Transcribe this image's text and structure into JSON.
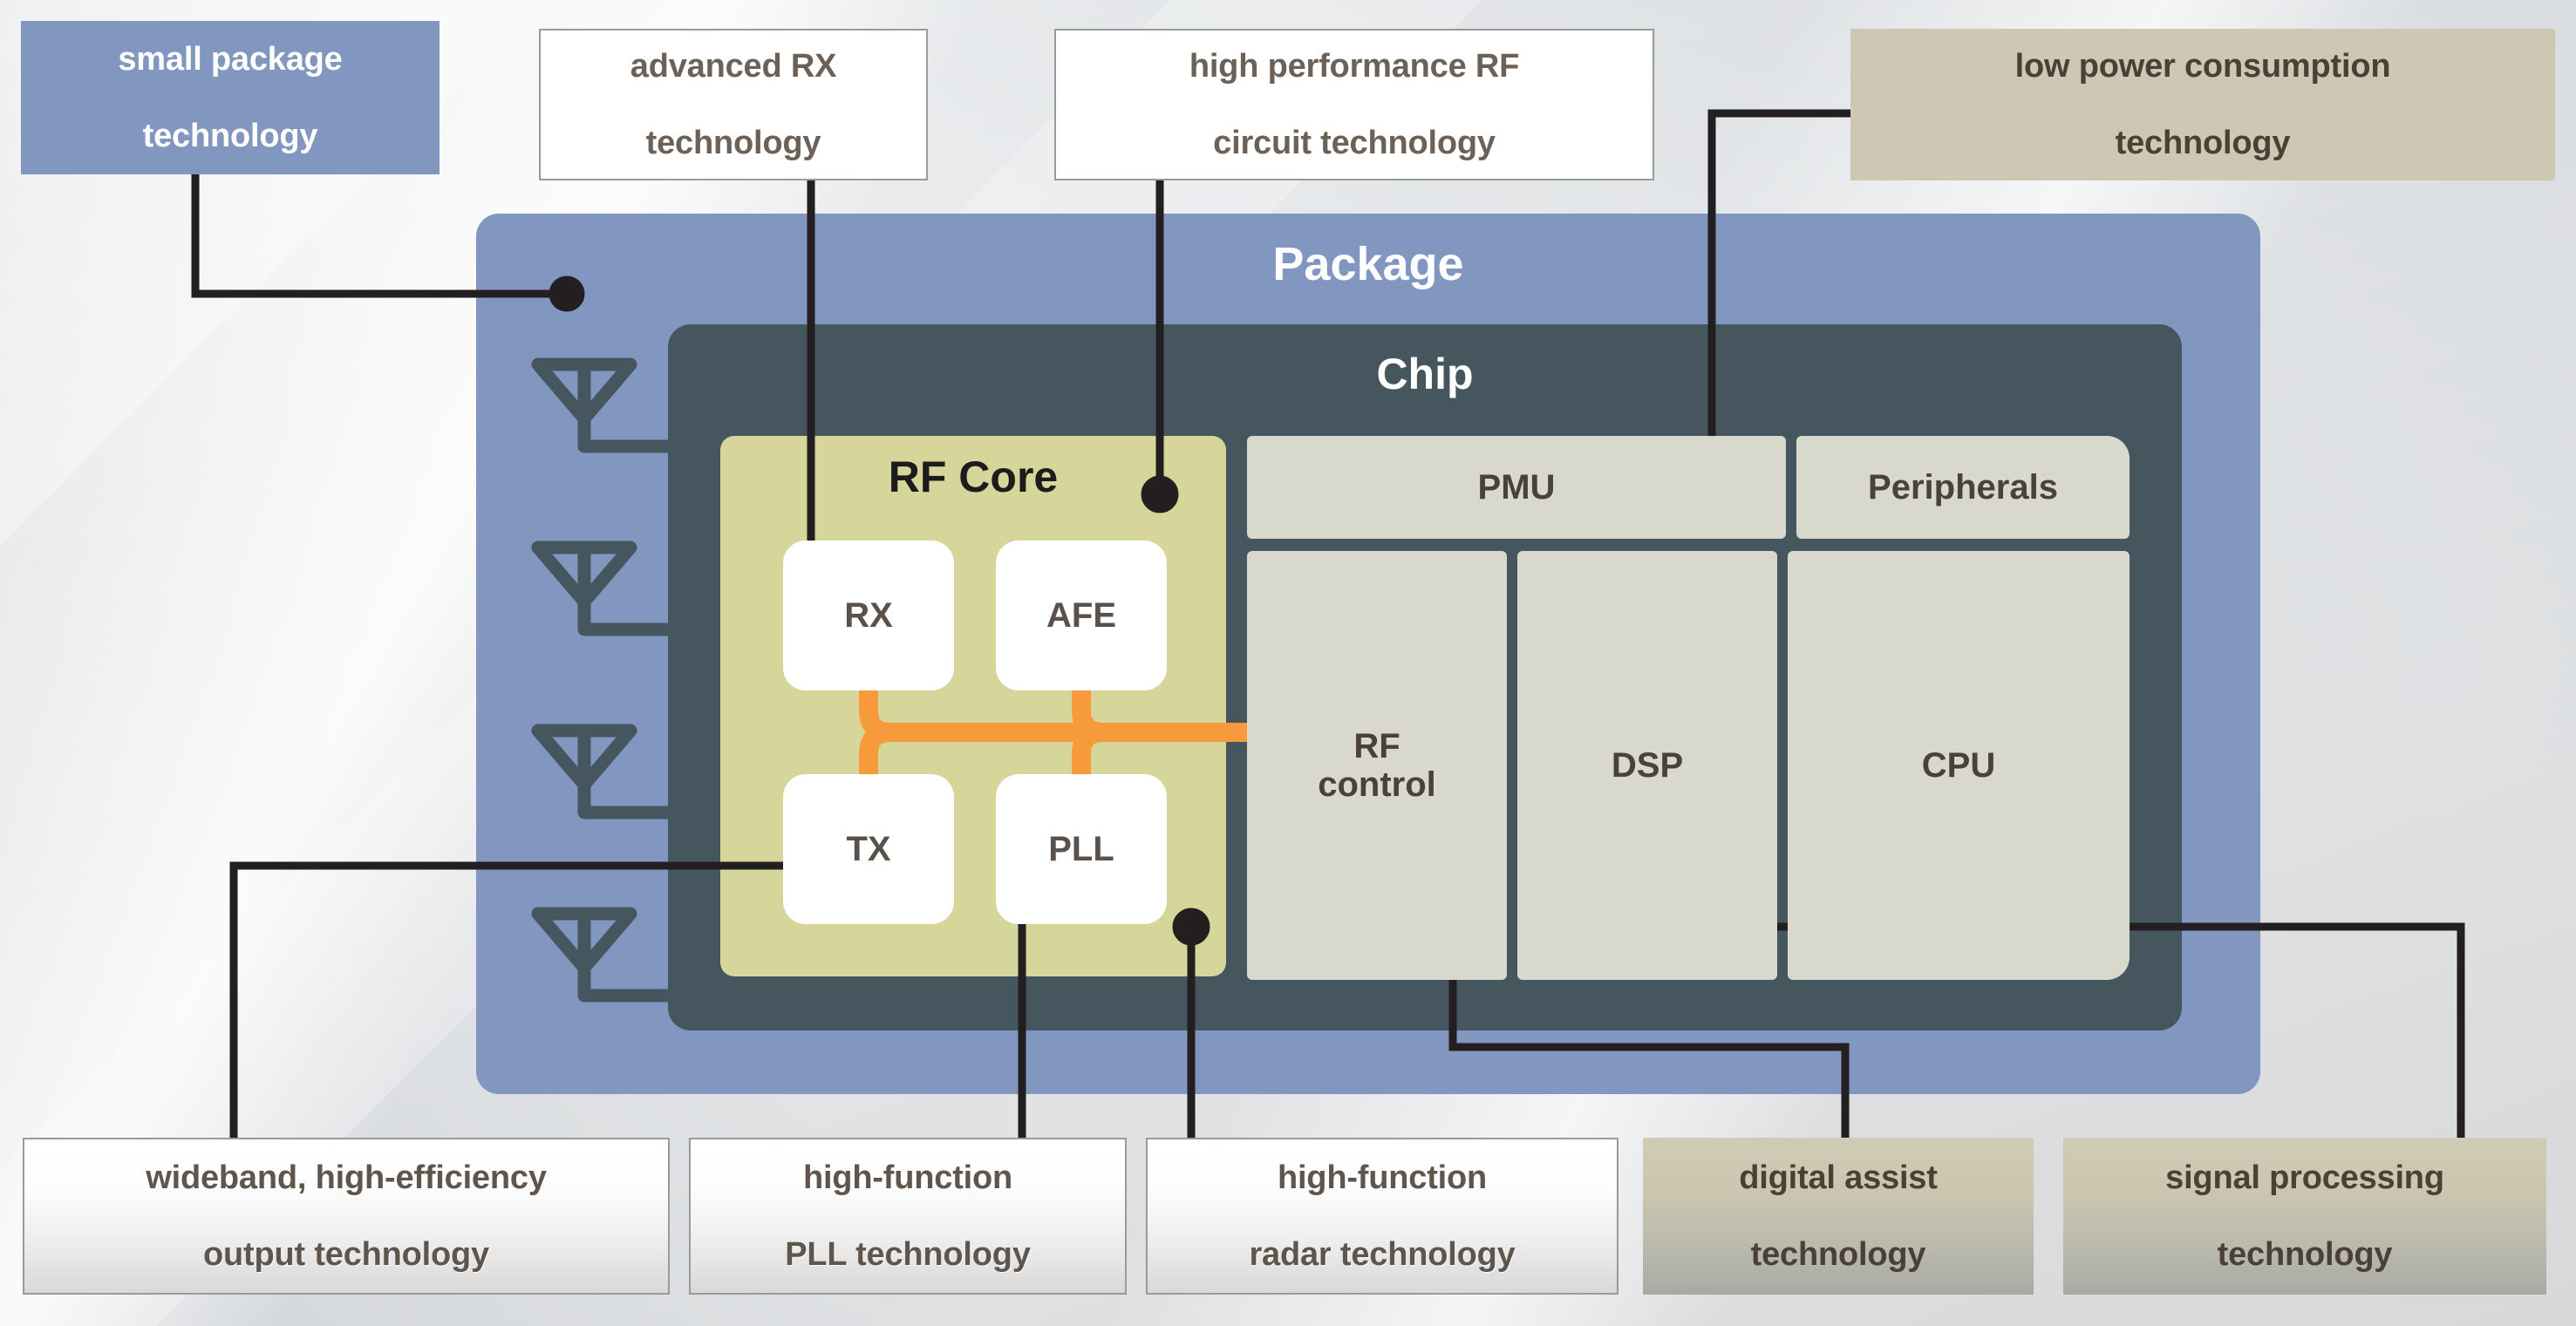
{
  "diagram": {
    "title": "RF SoC package / chip block diagram",
    "colors": {
      "package_fill": "#8197bf",
      "chip_fill": "#45565f",
      "rf_core_fill": "#d6d69a",
      "block_fill": "#d9d8cc",
      "sub_block_fill": "#ffffff",
      "bus_orange": "#f79a3c",
      "connector_line": "#231f20",
      "label_text": "#5f554d",
      "antenna": "#45565f"
    }
  },
  "containers": {
    "package_label": "Package",
    "chip_label": "Chip",
    "rf_core_label": "RF Core"
  },
  "chip_blocks": [
    {
      "id": "pmu",
      "label": "PMU"
    },
    {
      "id": "peripherals",
      "label": "Peripherals"
    },
    {
      "id": "rf_control",
      "label": "RF\ncontrol",
      "line1": "RF",
      "line2": "control"
    },
    {
      "id": "dsp",
      "label": "DSP"
    },
    {
      "id": "cpu",
      "label": "CPU"
    }
  ],
  "rf_core_blocks": [
    {
      "id": "rx",
      "label": "RX"
    },
    {
      "id": "afe",
      "label": "AFE"
    },
    {
      "id": "tx",
      "label": "TX"
    },
    {
      "id": "pll",
      "label": "PLL"
    }
  ],
  "antennas": {
    "count": 4,
    "icon": "antenna-icon"
  },
  "callouts_top": [
    {
      "id": "small-package",
      "line1": "small package",
      "line2": "technology",
      "style": "blue"
    },
    {
      "id": "advanced-rx",
      "line1": "advanced RX",
      "line2": "technology",
      "style": "plain"
    },
    {
      "id": "high-perf-rf",
      "line1": "high performance RF",
      "line2": "circuit technology",
      "style": "plain"
    },
    {
      "id": "low-power",
      "line1": "low power consumption",
      "line2": "technology",
      "style": "tan"
    }
  ],
  "callouts_bottom": [
    {
      "id": "wideband-output",
      "line1": "wideband, high-efficiency",
      "line2": "output technology",
      "style": "white"
    },
    {
      "id": "high-function-pll",
      "line1": "high-function",
      "line2": "PLL technology",
      "style": "white"
    },
    {
      "id": "high-function-radar",
      "line1": "high-function",
      "line2": "radar technology",
      "style": "white"
    },
    {
      "id": "digital-assist",
      "line1": "digital assist",
      "line2": "technology",
      "style": "tangrad"
    },
    {
      "id": "signal-processing",
      "line1": "signal processing",
      "line2": "technology",
      "style": "tangrad"
    }
  ],
  "connections": [
    {
      "from": "small-package",
      "to": "package-edge"
    },
    {
      "from": "advanced-rx",
      "to": "rx"
    },
    {
      "from": "high-perf-rf",
      "to": "rf-core"
    },
    {
      "from": "low-power",
      "to": "pmu"
    },
    {
      "from": "wideband-output",
      "to": "tx"
    },
    {
      "from": "high-function-pll",
      "to": "pll"
    },
    {
      "from": "high-function-radar",
      "to": "rf-core-bottom"
    },
    {
      "from": "digital-assist",
      "to": "rf-control"
    },
    {
      "from": "signal-processing",
      "to": "dsp"
    }
  ]
}
